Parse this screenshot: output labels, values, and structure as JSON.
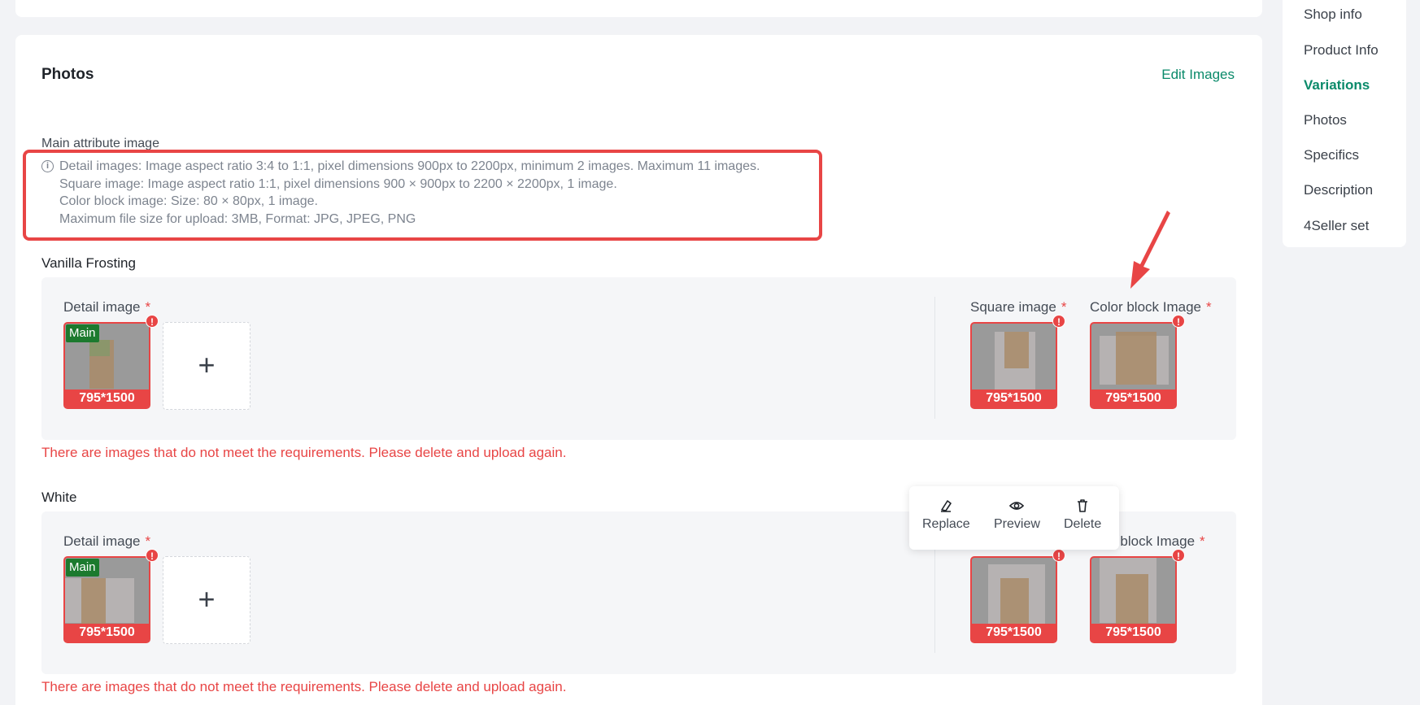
{
  "header": {
    "section_title": "Photos",
    "edit_link": "Edit Images",
    "main_attribute_label": "Main attribute image"
  },
  "requirements": {
    "lines": [
      "Detail images: Image aspect ratio 3:4 to 1:1, pixel dimensions 900px to 2200px, minimum 2 images. Maximum 11 images.",
      "Square image: Image aspect ratio 1:1, pixel dimensions 900 × 900px to 2200 × 2200px, 1 image.",
      "Color block image: Size: 80 × 80px, 1 image.",
      "Maximum file size for upload: 3MB, Format: JPG, JPEG, PNG"
    ],
    "highlight_color": "#e84545"
  },
  "variants": [
    {
      "name": "Vanilla Frosting",
      "detail_label": "Detail image",
      "square_label": "Square image",
      "color_block_label": "Color block Image",
      "required_mark": "*",
      "main_tag": "Main",
      "detail_dim": "795*1500",
      "square_dim": "795*1500",
      "color_block_dim": "795*1500",
      "warn_mark": "!",
      "add_icon": "+",
      "error": "There are images that do not meet the requirements. Please delete and upload again."
    },
    {
      "name": "White",
      "detail_label": "Detail image",
      "color_block_label_partial": "r block Image",
      "required_mark": "*",
      "main_tag": "Main",
      "detail_dim": "795*1500",
      "square_dim": "795*1500",
      "color_block_dim": "795*1500",
      "warn_mark": "!",
      "add_icon": "+",
      "error": "There are images that do not meet the requirements. Please delete and upload again."
    }
  ],
  "popover": {
    "replace": "Replace",
    "preview": "Preview",
    "delete": "Delete",
    "icons": [
      "eraser-icon",
      "eye-icon",
      "trash-icon"
    ]
  },
  "sidebar": {
    "items": [
      {
        "label": "Shop info"
      },
      {
        "label": "Product Info"
      },
      {
        "label": "Variations",
        "active": true
      },
      {
        "label": "Photos"
      },
      {
        "label": "Specifics"
      },
      {
        "label": "Description"
      },
      {
        "label": "4Seller set"
      }
    ],
    "active_color": "#0a8a6a"
  },
  "colors": {
    "error": "#e84545",
    "accent": "#0a8a6a",
    "main_tag": "#1c7a2e"
  }
}
